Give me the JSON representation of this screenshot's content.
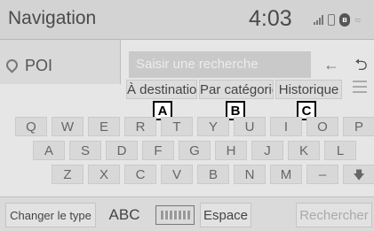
{
  "header": {
    "title": "Navigation",
    "time": "4:03"
  },
  "poi": {
    "label": "POI"
  },
  "search": {
    "placeholder": "Saisir une recherche",
    "backspace_symbol": "←",
    "enter_symbol": "⮌"
  },
  "tabs": [
    "À destination",
    "Par catégorie",
    "Historique"
  ],
  "callouts": [
    "A",
    "B",
    "C"
  ],
  "keyboard": {
    "row1": [
      "Q",
      "W",
      "E",
      "R",
      "T",
      "Y",
      "U",
      "I",
      "O",
      "P"
    ],
    "row2": [
      "A",
      "S",
      "D",
      "F",
      "G",
      "H",
      "J",
      "K",
      "L"
    ],
    "row3": [
      "Z",
      "X",
      "C",
      "V",
      "B",
      "N",
      "M",
      "–",
      "🡇"
    ]
  },
  "bottom": {
    "change_type": "Changer le type",
    "abc": "ABC",
    "space": "Espace",
    "search": "Rechercher"
  },
  "icons": [
    "signal-icon",
    "phone-icon",
    "bluetooth-icon",
    "wifi-icon",
    "map-pin-icon",
    "list-icon",
    "keyboard-icon"
  ]
}
